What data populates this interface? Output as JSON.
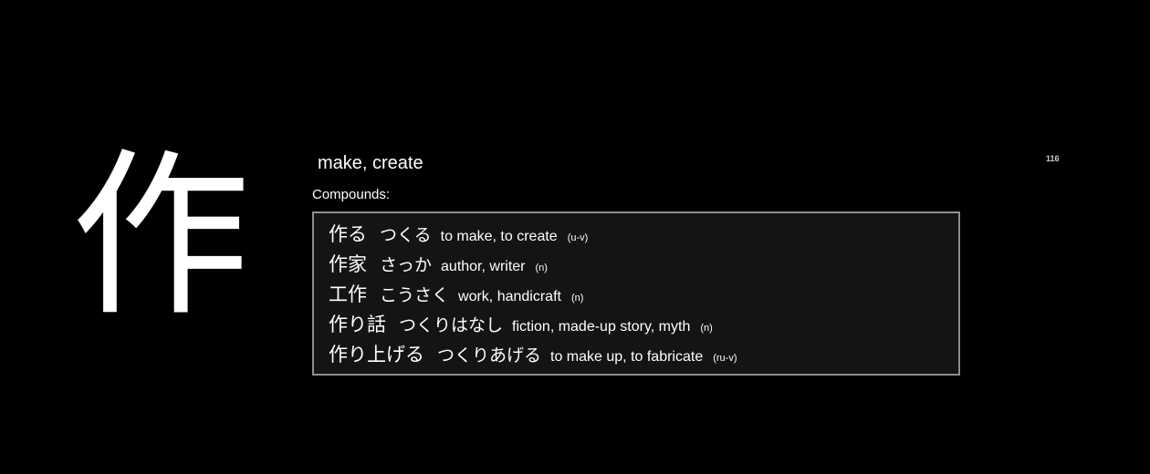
{
  "kanji": "作",
  "meaning": "make, create",
  "card_number": "116",
  "compounds_label": "Compounds:",
  "compounds": [
    {
      "word": "作る",
      "reading": "つくる",
      "gloss": "to make, to create",
      "pos": "(u-v)"
    },
    {
      "word": "作家",
      "reading": "さっか",
      "gloss": "author, writer",
      "pos": "(n)"
    },
    {
      "word": "工作",
      "reading": "こうさく",
      "gloss": "work, handicraft",
      "pos": "(n)"
    },
    {
      "word": "作り話",
      "reading": "つくりはなし",
      "gloss": "fiction, made-up story, myth",
      "pos": "(n)"
    },
    {
      "word": "作り上げる",
      "reading": "つくりあげる",
      "gloss": "to make up, to fabricate",
      "pos": "(ru-v)"
    }
  ],
  "colors": {
    "background": "#000000",
    "text": "#ffffff",
    "box_background": "#141414",
    "box_border": "#8e8e8e"
  }
}
